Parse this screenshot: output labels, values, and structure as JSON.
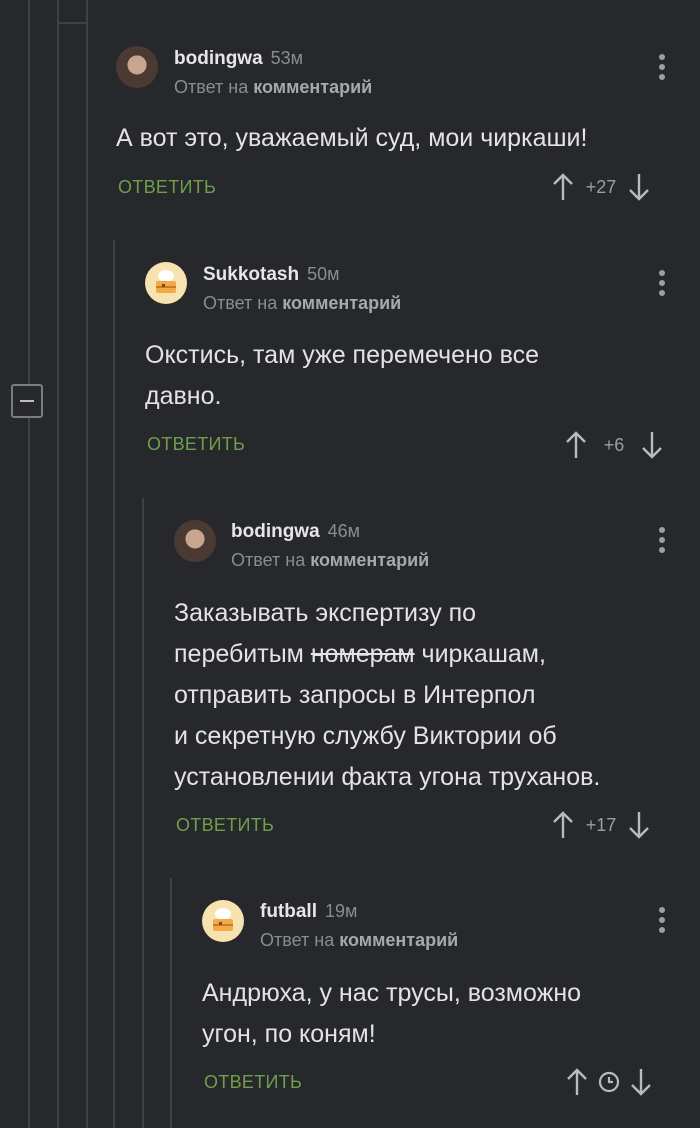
{
  "comments": [
    {
      "username": "bodingwa",
      "time": "53м",
      "reply_prefix": "Ответ на",
      "reply_target": "комментарий",
      "body_lines": [
        "А вот это, уважаемый суд, мои чиркаши!"
      ],
      "reply_label": "ответить",
      "score": "+27",
      "avatar": "woman-photo-avatar"
    },
    {
      "username": "Sukkotash",
      "time": "50м",
      "reply_prefix": "Ответ на",
      "reply_target": "комментарий",
      "body_lines": [
        "Окстись, там уже перемечено все",
        "давно."
      ],
      "reply_label": "ответить",
      "score": "+6",
      "avatar": "cake-avatar"
    },
    {
      "username": "bodingwa",
      "time": "46м",
      "reply_prefix": "Ответ на",
      "reply_target": "комментарий",
      "body_line1": "Заказывать экспертизу по",
      "body_line2_a": "перебитым ",
      "body_line2_struck": "номерам",
      "body_line2_b": " чиркашам,",
      "body_line3": "отправить запросы в Интерпол",
      "body_line4": "и секретную службу Виктории об",
      "body_line5": "установлении факта угона труханов.",
      "reply_label": "ответить",
      "score": "+17",
      "avatar": "woman-photo-avatar"
    },
    {
      "username": "futball",
      "time": "19м",
      "reply_prefix": "Ответ на",
      "reply_target": "комментарий",
      "body_lines": [
        "Андрюха, у нас трусы, возможно",
        "угон, по коням!"
      ],
      "reply_label": "ответить",
      "score_icon": "clock-icon",
      "avatar": "cake-avatar"
    }
  ],
  "colors": {
    "background": "#26282b",
    "reply_button": "#6f9f4c",
    "thread_line": "#3e4145"
  }
}
